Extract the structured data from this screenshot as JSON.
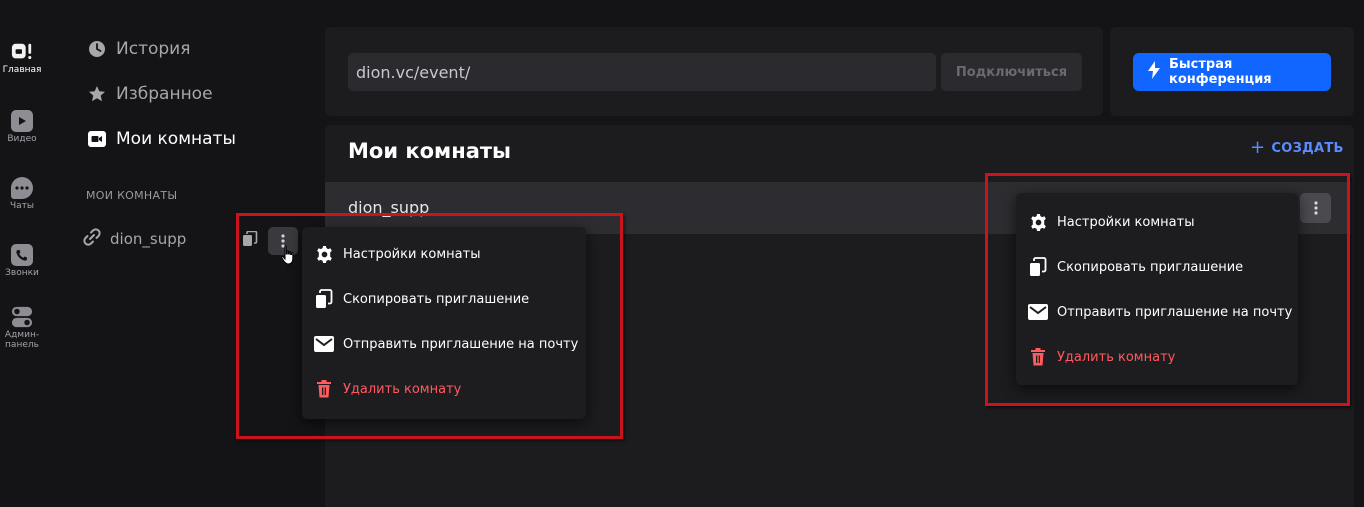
{
  "rail": {
    "items": [
      {
        "label": "Главная",
        "icon": "home-icon",
        "active": true
      },
      {
        "label": "Видео",
        "icon": "video-play-icon"
      },
      {
        "label": "Чаты",
        "icon": "chat-icon"
      },
      {
        "label": "Звонки",
        "icon": "calls-icon"
      },
      {
        "label": "Админ-\nпанель",
        "icon": "admin-toggle-icon"
      }
    ]
  },
  "sidebar": {
    "nav": [
      {
        "label": "История",
        "icon": "clock-icon"
      },
      {
        "label": "Избранное",
        "icon": "star-icon"
      },
      {
        "label": "Мои комнаты",
        "icon": "camera-icon",
        "active": true
      }
    ],
    "section_title": "МОИ КОМНАТЫ",
    "rooms": [
      {
        "label": "dion_supp",
        "icon": "link-icon"
      }
    ]
  },
  "header": {
    "url_value": "dion.vc/event/",
    "connect_label": "Подключиться",
    "quick_label": "Быстрая конференция"
  },
  "main": {
    "title": "Мои комнаты",
    "create_label": "СОЗДАТЬ",
    "rooms": [
      {
        "name": "dion_supp"
      }
    ]
  },
  "menu": {
    "items": [
      {
        "label": "Настройки комнаты",
        "icon": "gear-icon"
      },
      {
        "label": "Скопировать приглашение",
        "icon": "copy-icon"
      },
      {
        "label": "Отправить приглашение на почту",
        "icon": "mail-icon"
      },
      {
        "label": "Удалить комнату",
        "icon": "trash-icon",
        "danger": true
      }
    ]
  },
  "colors": {
    "accent": "#1166ff",
    "link": "#5a8cff",
    "danger": "#ff5a5f",
    "highlight_box": "#c8141a"
  }
}
